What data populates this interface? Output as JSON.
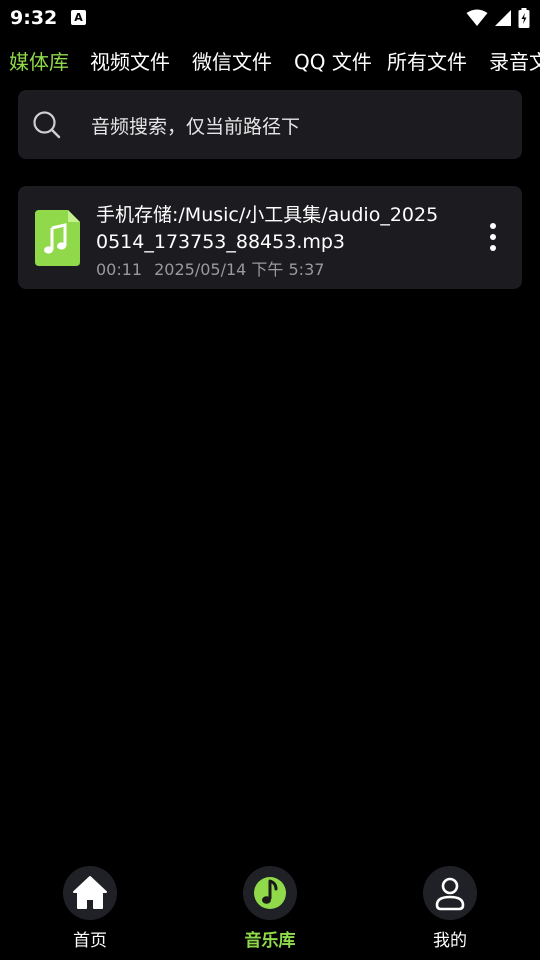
{
  "status_bar": {
    "time": "9:32",
    "notification_glyph": "A",
    "icons": [
      "wifi-icon",
      "signal-icon",
      "battery-icon"
    ]
  },
  "tabs": [
    {
      "label": "媒体库",
      "active": true
    },
    {
      "label": "视频文件",
      "active": false
    },
    {
      "label": "微信文件",
      "active": false
    },
    {
      "label": "QQ 文件",
      "active": false
    },
    {
      "label": "所有文件",
      "active": false
    },
    {
      "label": "录音文",
      "active": false
    }
  ],
  "search": {
    "placeholder": "音频搜索，仅当前路径下"
  },
  "files": [
    {
      "name": "手机存储:/Music/小工具集/audio_20250514_173753_88453.mp3",
      "duration": "00:11",
      "date": "2025/05/14 下午 5:37",
      "icon": "music-file-icon"
    }
  ],
  "bottom_nav": [
    {
      "label": "首页",
      "icon": "home-icon",
      "active": false
    },
    {
      "label": "音乐库",
      "icon": "music-library-icon",
      "active": true
    },
    {
      "label": "我的",
      "icon": "profile-icon",
      "active": false
    }
  ],
  "colors": {
    "accent": "#8fd94a",
    "background": "#000000",
    "card": "#1b1b20",
    "secondary_text": "#9a9a9a"
  }
}
